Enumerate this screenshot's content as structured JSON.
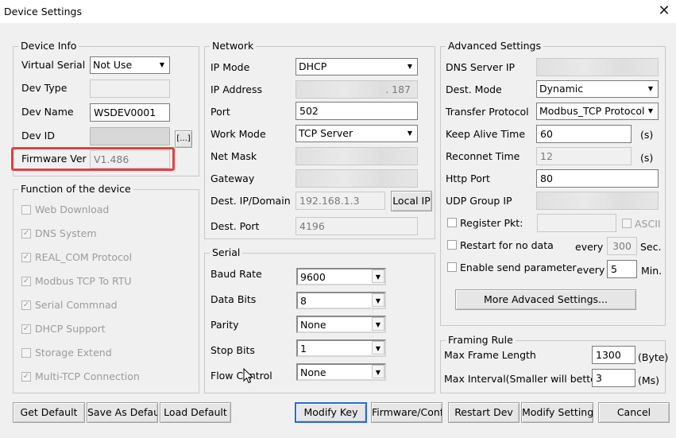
{
  "window": {
    "title": "Device Settings"
  },
  "device_info": {
    "title": "Device Info",
    "virtual_serial_label": "Virtual Serial",
    "virtual_serial_value": "Not Use",
    "dev_type_label": "Dev Type",
    "dev_type_value": "",
    "dev_name_label": "Dev Name",
    "dev_name_value": "WSDEV0001",
    "dev_id_label": "Dev ID",
    "dev_id_button": "[...]",
    "firmware_label": "Firmware Ver",
    "firmware_value": "V1.486"
  },
  "function": {
    "title": "Function of the device",
    "items": [
      {
        "label": "Web Download",
        "checked": false
      },
      {
        "label": "DNS System",
        "checked": true
      },
      {
        "label": "REAL_COM Protocol",
        "checked": true
      },
      {
        "label": "Modbus TCP To RTU",
        "checked": true
      },
      {
        "label": "Serial Commnad",
        "checked": true
      },
      {
        "label": "DHCP Support",
        "checked": true
      },
      {
        "label": "Storage Extend",
        "checked": false
      },
      {
        "label": "Multi-TCP Connection",
        "checked": true
      }
    ]
  },
  "network": {
    "title": "Network",
    "ip_mode_label": "IP Mode",
    "ip_mode_value": "DHCP",
    "ip_address_label": "IP Address",
    "ip_address_suffix": ". 187",
    "port_label": "Port",
    "port_value": "502",
    "work_mode_label": "Work Mode",
    "work_mode_value": "TCP Server",
    "net_mask_label": "Net Mask",
    "gateway_label": "Gateway",
    "dest_ip_label": "Dest. IP/Domain",
    "dest_ip_value": "192.168.1.3",
    "local_ip_button": "Local IP",
    "dest_port_label": "Dest. Port",
    "dest_port_value": "4196"
  },
  "serial": {
    "title": "Serial",
    "baud_rate_label": "Baud Rate",
    "baud_rate_value": "9600",
    "data_bits_label": "Data Bits",
    "data_bits_value": "8",
    "parity_label": "Parity",
    "parity_value": "None",
    "stop_bits_label": "Stop Bits",
    "stop_bits_value": "1",
    "flow_control_label": "Flow Control",
    "flow_control_value": "None"
  },
  "advanced": {
    "title": "Advanced Settings",
    "dns_server_label": "DNS Server IP",
    "dest_mode_label": "Dest. Mode",
    "dest_mode_value": "Dynamic",
    "transfer_protocol_label": "Transfer Protocol",
    "transfer_protocol_value": "Modbus_TCP Protocol",
    "keep_alive_label": "Keep Alive Time",
    "keep_alive_value": "60",
    "keep_alive_unit": "(s)",
    "reconnect_label": "Reconnet Time",
    "reconnect_value": "12",
    "reconnect_unit": "(s)",
    "http_port_label": "Http Port",
    "http_port_value": "80",
    "udp_group_label": "UDP Group IP",
    "register_pkt_label": "Register Pkt:",
    "ascii_label": "ASCII",
    "restart_label": "Restart for no data",
    "restart_every": "every",
    "restart_value": "300",
    "restart_unit": "Sec.",
    "enable_send_label": "Enable send parameter",
    "enable_every": "every",
    "enable_value": "5",
    "enable_unit": "Min.",
    "more_button": "More Advaced Settings..."
  },
  "framing": {
    "title": "Framing Rule",
    "max_frame_label": "Max Frame Length",
    "max_frame_value": "1300",
    "max_frame_unit": "(Byte)",
    "max_interval_label": "Max Interval(Smaller will better)",
    "max_interval_value": "3",
    "max_interval_unit": "(Ms)"
  },
  "buttons": {
    "get_default": "Get Default",
    "save_as_default": "Save As Default",
    "load_default": "Load Default",
    "modify_key": "Modify Key",
    "firmware_config": "Firmware/Config",
    "restart_dev": "Restart Dev",
    "modify_setting": "Modify Setting",
    "cancel": "Cancel"
  },
  "icons": {
    "close": "close-icon",
    "dropdown": "chevron-down-icon",
    "checkmark": "check-icon",
    "cursor": "mouse-pointer-icon"
  },
  "colors": {
    "highlight": "#e0413f",
    "background": "#f0f0f0",
    "disabled_text": "#9b9b9b"
  }
}
